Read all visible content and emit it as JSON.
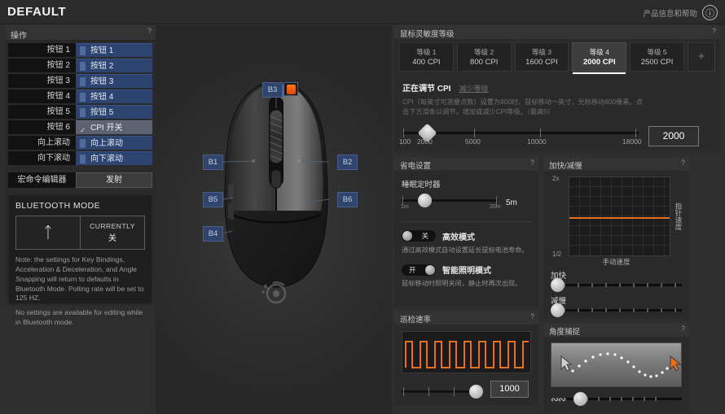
{
  "header": {
    "title": "DEFAULT",
    "help_label": "产品信息和帮助",
    "help_icon": "info-icon"
  },
  "bindings_panel": {
    "title": "操作",
    "help": "?",
    "rows": [
      {
        "name": "按钮 1",
        "value": "按钮 1",
        "highlight": false
      },
      {
        "name": "按钮 2",
        "value": "按钮 2",
        "highlight": false
      },
      {
        "name": "按钮 3",
        "value": "按钮 3",
        "highlight": false
      },
      {
        "name": "按钮 4",
        "value": "按钮 4",
        "highlight": false
      },
      {
        "name": "按钮 5",
        "value": "按钮 5",
        "highlight": false
      },
      {
        "name": "按钮 6",
        "value": "CPI 开关",
        "highlight": true
      },
      {
        "name": "向上滚动",
        "value": "向上滚动",
        "highlight": false
      },
      {
        "name": "向下滚动",
        "value": "向下滚动",
        "highlight": false
      }
    ],
    "macro_label": "宏命令编辑器",
    "macro_button": "发射"
  },
  "bluetooth": {
    "title": "BLUETOOTH MODE",
    "icon": "bluetooth-icon",
    "currently_label": "CURRENTLY",
    "currently_state": "关",
    "note1": "Note: the settings for Key Bindings, Acceleration & Deceleration, and Angle Snapping will return to defaults in Bluetooth Mode. Polling rate will be set to 125 HZ.",
    "note2": "No settings are available for editing while in Bluetooth mode."
  },
  "mouse_diagram": {
    "callouts": [
      {
        "id": "B3",
        "has_icon": true
      },
      {
        "id": "B1",
        "has_icon": false
      },
      {
        "id": "B2",
        "has_icon": false
      },
      {
        "id": "B5",
        "has_icon": false
      },
      {
        "id": "B6",
        "has_icon": false
      },
      {
        "id": "B4",
        "has_icon": false
      }
    ],
    "brand_logo": "steelseries-logo"
  },
  "cpi": {
    "title": "鼠标灵敏度等级",
    "help": "?",
    "levels": [
      {
        "label": "等级 1",
        "value": "400 CPI",
        "active": false
      },
      {
        "label": "等级 2",
        "value": "800 CPI",
        "active": false
      },
      {
        "label": "等级 3",
        "value": "1600 CPI",
        "active": false
      },
      {
        "label": "等级 4",
        "value": "2000 CPI",
        "active": true
      },
      {
        "label": "等级 5",
        "value": "2500 CPI",
        "active": false
      }
    ],
    "add_button": "+",
    "adjusting_label": "正在调节 CPI",
    "reduce_link": "减少等级",
    "description": "CPI（每英寸可测量点数）设置为800时，鼠标移动一英寸，光标移动800像素。点击下方滑条以调节。增加或减少CPI等级。（最高5）",
    "slider": {
      "ticks": [
        "100",
        "2000",
        "5000",
        "10000",
        "18000"
      ],
      "value": "2000",
      "knob_percent": 10
    }
  },
  "power": {
    "title": "省电设置",
    "help": "?",
    "sleep_label": "睡眠定时器",
    "sleep_value": "5m",
    "sleep_min": "1m",
    "sleep_max": "20m",
    "sleep_knob_percent": 22,
    "efficiency": {
      "state_label": "关",
      "name": "高效模式",
      "on": false,
      "desc": "通过高效模式自动设置延长鼠标电池寿命。"
    },
    "smart_light": {
      "state_label": "开",
      "name": "智能照明模式",
      "on": true,
      "desc": "鼠标移动时照明关闭，静止时再次出现。"
    }
  },
  "polling": {
    "title": "巡检速率",
    "help": "?",
    "value": "1000",
    "knob_percent": 83,
    "wave_color": "#e8701a"
  },
  "acceleration": {
    "title": "加快/减慢",
    "help": "?",
    "y_top": "2x",
    "y_bottom": "1/2",
    "x_label": "手动速度",
    "y_label": "指针速度",
    "accel_label": "加快",
    "decel_label": "减慢",
    "accel_knob_percent": 0,
    "decel_knob_percent": 0,
    "line_color": "#e8701a"
  },
  "angle_snapping": {
    "title": "角度捕捉",
    "help": "?",
    "wave_icon": "wave-icon",
    "knob_percent": 10,
    "cursor_left": "cursor-arrow-icon",
    "cursor_right": "cursor-arrow-icon"
  },
  "chart_data": [
    {
      "type": "line",
      "title": "加快/减慢",
      "xlabel": "手动速度",
      "ylabel": "指针速度",
      "ylim": [
        0.5,
        2
      ],
      "ytick_labels": [
        "2x",
        "1/2"
      ],
      "grid": true,
      "series": [
        {
          "name": "pointer-response",
          "x": [
            0,
            1
          ],
          "values": [
            1,
            1
          ]
        }
      ]
    },
    {
      "type": "line",
      "title": "巡检速率",
      "xlabel": "",
      "ylabel": "",
      "grid": false,
      "annotation": "square wave, 10 pulses, 1000 Hz",
      "series": [
        {
          "name": "polling-pulse",
          "values": [
            0,
            1,
            0,
            1,
            0,
            1,
            0,
            1,
            0,
            1,
            0,
            1,
            0,
            1,
            0,
            1,
            0,
            1,
            0,
            1,
            0
          ]
        }
      ]
    },
    {
      "type": "scatter",
      "title": "角度捕捉",
      "xlabel": "",
      "ylabel": "",
      "grid": false,
      "annotation": "sine-shaped dotted cursor path between two cursor arrows",
      "series": [
        {
          "name": "cursor-path",
          "values": [
            0.25,
            0.45,
            0.62,
            0.78,
            0.88,
            0.93,
            0.92,
            0.85,
            0.74,
            0.6,
            0.45,
            0.3,
            0.18,
            0.1,
            0.08,
            0.12,
            0.2,
            0.32,
            0.46
          ]
        }
      ]
    }
  ]
}
